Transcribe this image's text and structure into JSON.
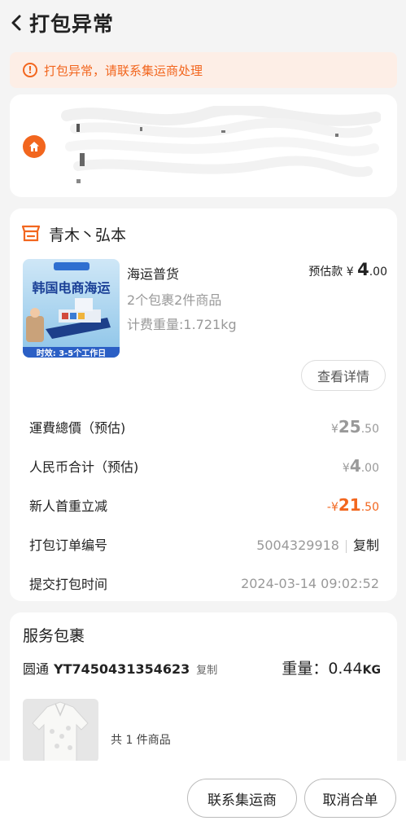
{
  "header": {
    "title": "打包异常"
  },
  "alert": {
    "text": "打包异常，请联系集运商处理"
  },
  "shop": {
    "name": "青木丶弘本"
  },
  "product": {
    "title": "海运普货",
    "price_label": "预估款 ¥ ",
    "price_int": "4",
    "price_dec": ".00",
    "packages": "2个包裹2件商品",
    "weight": "计费重量:1.721kg",
    "thumb_headline": "韩国电商海运",
    "thumb_footer": "时效: 3-5个工作日",
    "detail_button": "查看详情"
  },
  "summary": {
    "rows": [
      {
        "label": "運費總價（预估)",
        "prefix": "¥",
        "int": "25",
        "dec": ".50"
      },
      {
        "label": "人民币合计（预估)",
        "prefix": "¥",
        "int": "4",
        "dec": ".00"
      },
      {
        "label": "新人首重立减",
        "prefix": "-¥",
        "int": "21",
        "dec": ".50"
      }
    ],
    "order_label": "打包订单编号",
    "order_no": "5004329918",
    "copy_label": "复制",
    "time_label": "提交打包时间",
    "time_value": "2024-03-14 09:02:52"
  },
  "service": {
    "title": "服务包裹",
    "carrier": "圆通",
    "tracking": "YT7450431354623",
    "copy_label": "复制",
    "weight_label": "重量：",
    "weight_value": "0.44",
    "weight_unit": "KG",
    "item_count": "共 1 件商品"
  },
  "actions": {
    "contact": "联系集运商",
    "cancel": "取消合单"
  },
  "colors": {
    "accent": "#f2661e",
    "alert_bg": "#fdeee6"
  }
}
